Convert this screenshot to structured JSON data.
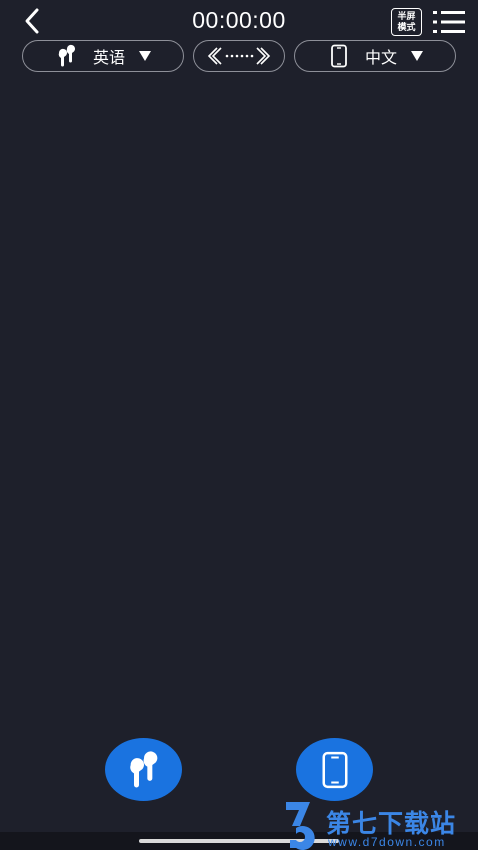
{
  "header": {
    "timer": "00:00:00",
    "half_screen_label_line1": "半屏",
    "half_screen_label_line2": "模式",
    "back_icon": "chevron-left-icon",
    "menu_icon": "list-menu-icon"
  },
  "languages": {
    "source_label": "英语",
    "source_icon": "earbuds-icon",
    "swap_icon": "bidirectional-arrows-icon",
    "target_label": "中文",
    "target_icon": "phone-icon"
  },
  "actions": {
    "earbuds_icon": "earbuds-icon",
    "phone_icon": "phone-icon"
  },
  "watermark": {
    "title": "第七下载站",
    "url": "www.d7down.com"
  },
  "colors": {
    "background": "#1e202b",
    "accent_blue": "#1a73e0",
    "pill_border": "#8e9099",
    "watermark_blue": "#3b86e6"
  }
}
